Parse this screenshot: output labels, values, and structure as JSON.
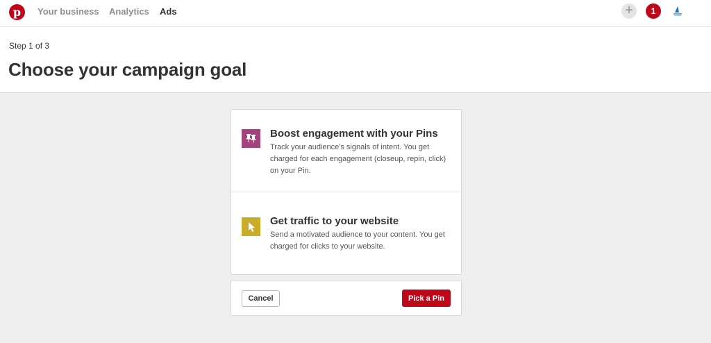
{
  "nav": {
    "logo_letter": "p",
    "links": [
      "Your business",
      "Analytics",
      "Ads"
    ],
    "notification_count": "1",
    "plus_icon": "+"
  },
  "header": {
    "step": "Step 1 of 3",
    "title": "Choose your campaign goal"
  },
  "goals": [
    {
      "icon": "pushpin-icon",
      "icon_color": "#a3437e",
      "title": "Boost engagement with your Pins",
      "description": "Track your audience's signals of intent. You get charged for each engagement (closeup, repin, click) on your Pin."
    },
    {
      "icon": "cursor-icon",
      "icon_color": "#c9ad2a",
      "title": "Get traffic to your website",
      "description": "Send a motivated audience to your content. You get charged for clicks to your website."
    }
  ],
  "footer": {
    "cancel_label": "Cancel",
    "pick_label": "Pick a Pin"
  },
  "colors": {
    "brand": "#bd081c",
    "background": "#efefef"
  }
}
